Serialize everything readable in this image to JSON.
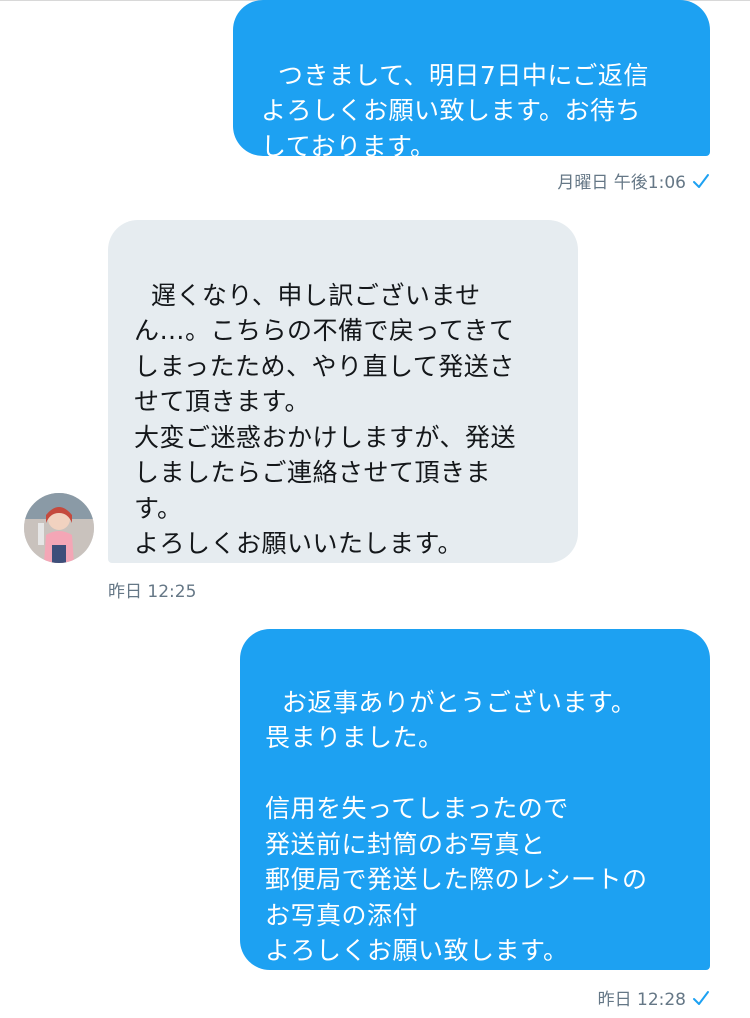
{
  "conversation": {
    "messages": [
      {
        "direction": "outgoing",
        "text": "つきまして、明日7日中にご返信\nよろしくお願い致します。お待ち\nしております。",
        "timestamp": "月曜日 午後1:06",
        "read_icon": "checkmark-icon"
      },
      {
        "direction": "incoming",
        "text": "遅くなり、申し訳ございませ\nん…。こちらの不備で戻ってきて\nしまったため、やり直して発送さ\nせて頂きます。\n大変ご迷惑おかけしますが、発送\nしましたらご連絡させて頂きま\nす。\nよろしくお願いいたします。",
        "timestamp": "昨日 12:25",
        "avatar_icon": "user-avatar-icon"
      },
      {
        "direction": "outgoing",
        "text": "お返事ありがとうございます。\n畏まりました。\n\n信用を失ってしまったので\n発送前に封筒のお写真と\n郵便局で発送した際のレシートの\nお写真の添付\nよろしくお願い致します。",
        "timestamp": "昨日 12:28",
        "read_icon": "checkmark-icon"
      }
    ]
  },
  "colors": {
    "outgoing_bubble": "#1da1f2",
    "incoming_bubble": "#e6ecf0",
    "meta_text": "#657786",
    "check": "#1da1f2"
  }
}
